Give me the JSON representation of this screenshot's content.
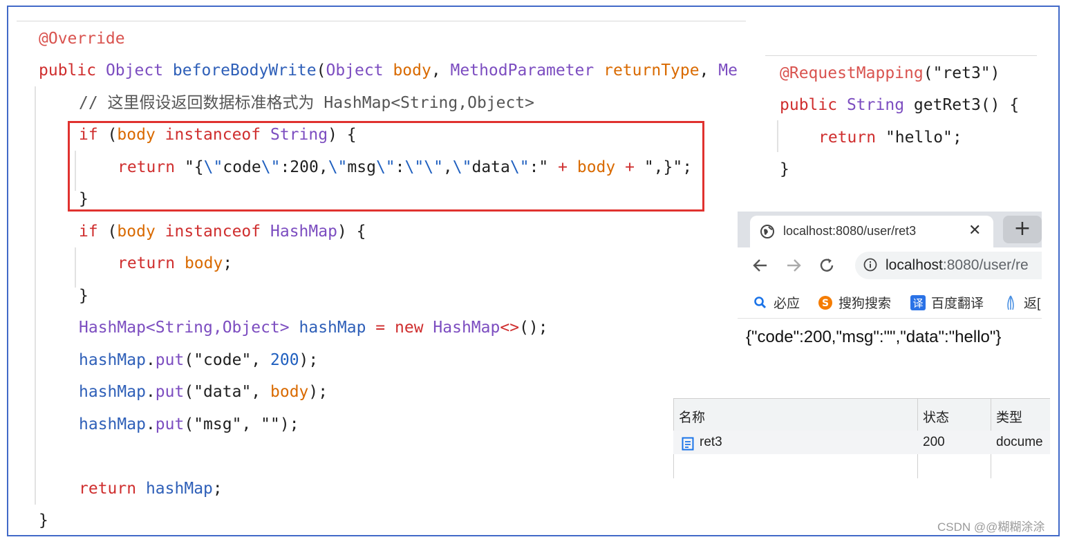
{
  "main_code": {
    "annotation": "@Override",
    "signature": {
      "kw_public": "public",
      "ret_type": "Object",
      "method": "beforeBodyWrite",
      "p1_type": "Object",
      "p1_name": "body",
      "p2_type": "MethodParameter",
      "p2_name": "returnType",
      "p3_type_truncated": "Me"
    },
    "comment": "// 这里假设返回数据标准格式为 HashMap<String,Object>",
    "if1": {
      "kw": "if",
      "var": "body",
      "op": "instanceof",
      "type": "String"
    },
    "ret1": {
      "kw": "return",
      "str_a": "\"{",
      "esc1": "\\\"",
      "code": "code",
      "esc2": "\\\"",
      "colon200": ":200,",
      "esc3": "\\\"",
      "msg": "msg",
      "esc4": "\\\"",
      "colon_empty": ":",
      "esc5": "\\\"",
      "esc6": "\\\"",
      "comma": ",",
      "esc7": "\\\"",
      "data": "data",
      "esc8": "\\\"",
      "colon_end": ":\"",
      "plus": "+",
      "var": "body",
      "str_end": "\",}\";"
    },
    "if2": {
      "kw": "if",
      "var": "body",
      "op": "instanceof",
      "type": "HashMap"
    },
    "ret2": {
      "kw": "return",
      "var": "body"
    },
    "decl": {
      "type": "HashMap<String,Object>",
      "name": "hashMap",
      "op": "=",
      "kw_new": "new",
      "ctor": "HashMap",
      "diamond": "<>",
      "tail": "();"
    },
    "put_code": {
      "obj": "hashMap",
      "fn": "put",
      "key": "\"code\"",
      "val": "200"
    },
    "put_data": {
      "obj": "hashMap",
      "fn": "put",
      "key": "\"data\"",
      "val": "body"
    },
    "put_msg": {
      "obj": "hashMap",
      "fn": "put",
      "key": "\"msg\"",
      "val": "\"\""
    },
    "ret3": {
      "kw": "return",
      "var": "hashMap"
    },
    "close_brace": "}"
  },
  "side_code": {
    "annotation": "@RequestMapping",
    "annotation_arg": "(\"ret3\")",
    "kw_public": "public",
    "ret_type": "String",
    "method": "getRet3() {",
    "kw_return": "return",
    "ret_value": "\"hello\";",
    "close_brace": "}"
  },
  "browser": {
    "tab_title": "localhost:8080/user/ret3",
    "tab_close": "✕",
    "new_tab": "+",
    "url_host": "localhost",
    "url_rest": ":8080/user/re",
    "bookmarks": [
      {
        "label": "必应",
        "icon": "search-icon"
      },
      {
        "label": "搜狗搜索",
        "icon": "sogou-icon"
      },
      {
        "label": "百度翻译",
        "icon": "translate-icon"
      },
      {
        "label": "返[",
        "icon": "bookmark-icon"
      }
    ],
    "response_body": "{\"code\":200,\"msg\":\"\",\"data\":\"hello\"}"
  },
  "network": {
    "columns": [
      "名称",
      "状态",
      "类型"
    ],
    "rows": [
      {
        "name": "ret3",
        "status": "200",
        "type": "docume"
      }
    ]
  },
  "watermark": "CSDN @@糊糊涂涂",
  "colors": {
    "keyword": "#cf2e2e",
    "type": "#7c4dc0",
    "function": "#2e5fb8",
    "variable": "#d96a00",
    "highlight_border": "#e0322f",
    "frame_border": "#4169c8"
  }
}
